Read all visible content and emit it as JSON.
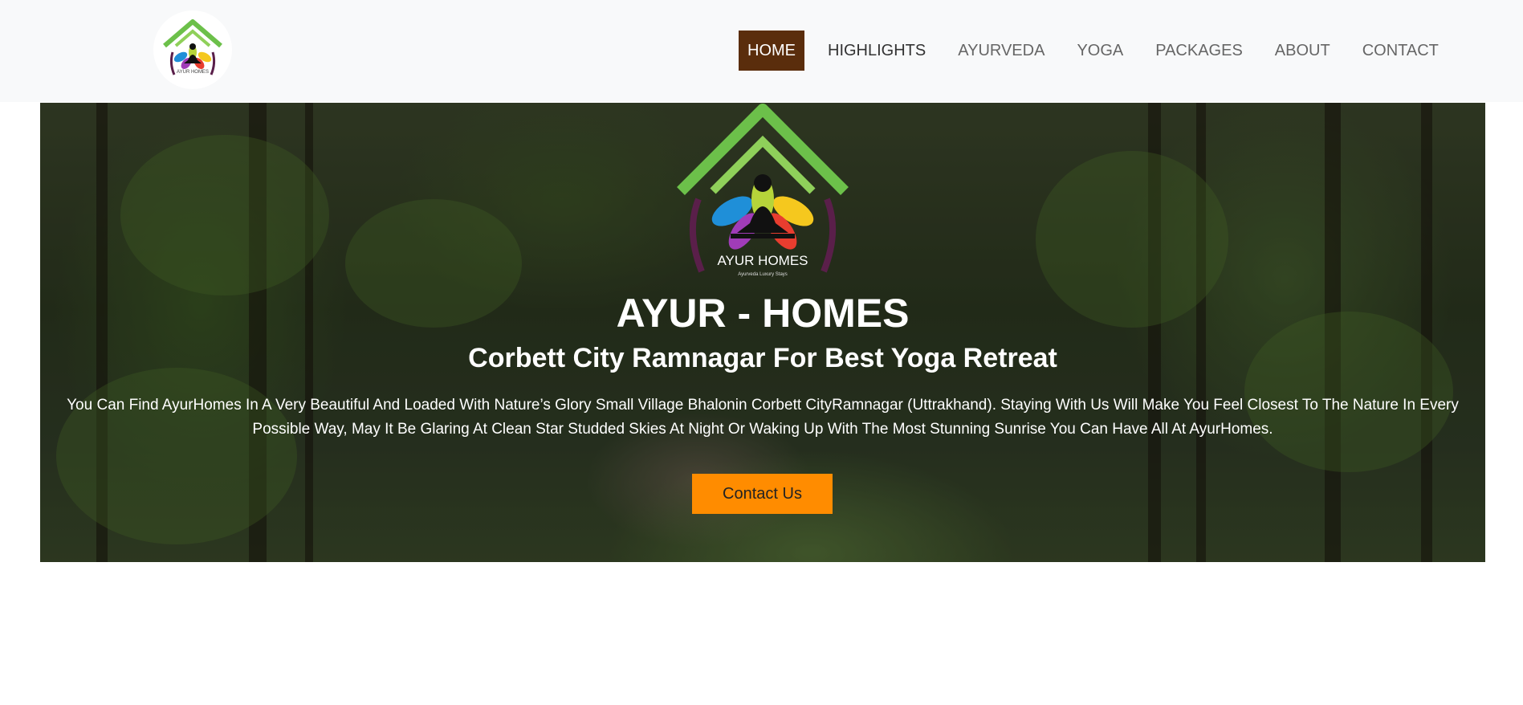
{
  "nav": {
    "logo_text": "AYUR HOMES",
    "items": [
      {
        "label": "HOME",
        "active": true
      },
      {
        "label": "HIGHLIGHTS"
      },
      {
        "label": "AYURVEDA"
      },
      {
        "label": "YOGA"
      },
      {
        "label": "PACKAGES"
      },
      {
        "label": "ABOUT"
      },
      {
        "label": "CONTACT"
      }
    ]
  },
  "hero": {
    "logo_text": "AYUR HOMES",
    "logo_tagline": "Ayurveda Luxury Stays",
    "title": "AYUR - HOMES",
    "subtitle": "Corbett City Ramnagar For Best Yoga Retreat",
    "description": "You Can Find AyurHomes In A Very Beautiful And Loaded With Nature’s Glory Small Village Bhalonin Corbett CityRamnagar (Uttrakhand). Staying With Us Will Make You Feel Closest To The Nature In Every Possible Way, May It Be Glaring At Clean Star Studded Skies At Night Or Waking Up With The Most Stunning Sunrise You Can Have All At AyurHomes.",
    "button_label": "Contact Us"
  },
  "colors": {
    "nav_background": "#f8f9fa",
    "active_nav": "#5a2d0c",
    "button": "#ff8c00",
    "roof_green": "#6cc04a"
  }
}
